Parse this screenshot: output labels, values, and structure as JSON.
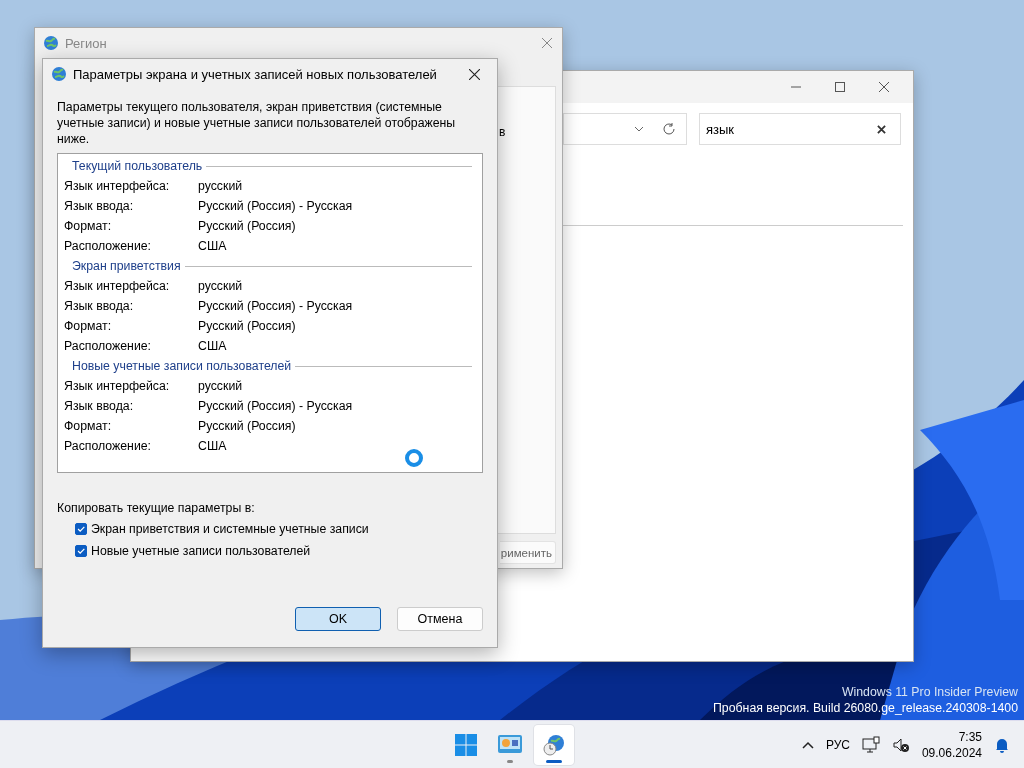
{
  "explorer": {
    "search": {
      "value": "язык"
    }
  },
  "region_window": {
    "title": "Регион",
    "fragment_text": "в",
    "apply_button": "рименить"
  },
  "dialog": {
    "title": "Параметры экрана и учетных записей новых пользователей",
    "description": "Параметры текущего пользователя, экран приветствия (системные учетные записи) и новые учетные записи пользователей отображены ниже.",
    "sections": [
      {
        "title": "Текущий пользователь",
        "rows": [
          {
            "label": "Язык интерфейса:",
            "value": "русский"
          },
          {
            "label": "Язык ввода:",
            "value": "Русский (Россия) - Русская"
          },
          {
            "label": "Формат:",
            "value": "Русский (Россия)"
          },
          {
            "label": "Расположение:",
            "value": "США"
          }
        ]
      },
      {
        "title": "Экран приветствия",
        "rows": [
          {
            "label": "Язык интерфейса:",
            "value": "русский"
          },
          {
            "label": "Язык ввода:",
            "value": "Русский (Россия) - Русская"
          },
          {
            "label": "Формат:",
            "value": "Русский (Россия)"
          },
          {
            "label": "Расположение:",
            "value": "США"
          }
        ]
      },
      {
        "title": "Новые учетные записи пользователей",
        "rows": [
          {
            "label": "Язык интерфейса:",
            "value": "русский"
          },
          {
            "label": "Язык ввода:",
            "value": "Русский (Россия) - Русская"
          },
          {
            "label": "Формат:",
            "value": "Русский (Россия)"
          },
          {
            "label": "Расположение:",
            "value": "США"
          }
        ]
      }
    ],
    "copy_label": "Копировать текущие параметры в:",
    "checkboxes": [
      {
        "label": "Экран приветствия и системные учетные записи",
        "checked": true
      },
      {
        "label": "Новые учетные записи пользователей",
        "checked": true
      }
    ],
    "buttons": [
      {
        "label": "OK",
        "selected": true
      },
      {
        "label": "Отмена",
        "selected": false
      }
    ]
  },
  "watermark": [
    "Windows 11 Pro Insider Preview",
    "Пробная версия. Build 26080.ge_release.240308-1400"
  ],
  "taskbar": {
    "apps": [
      {
        "kind": "start",
        "selected": false
      },
      {
        "kind": "control-panel",
        "selected": false
      },
      {
        "kind": "region",
        "selected": true
      }
    ],
    "language": "РУС",
    "time": "7:35",
    "date": "09.06.2024"
  }
}
